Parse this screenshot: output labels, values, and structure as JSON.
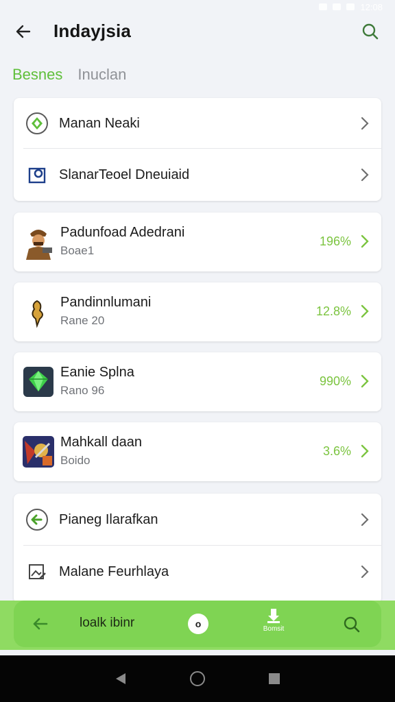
{
  "status_bar": {
    "time": "12:08"
  },
  "header": {
    "title": "Indayjsia",
    "back_icon": "arrow-left-icon",
    "search_icon": "search-icon"
  },
  "tabs": [
    {
      "label": "Besnes",
      "active": true
    },
    {
      "label": "Inuclan",
      "active": false
    }
  ],
  "settings_top": [
    {
      "label": "Manan Neaki",
      "icon": "diamond-circle-icon"
    },
    {
      "label": "SlanarTeoel Dneuiaid",
      "icon": "phone-frame-icon"
    }
  ],
  "apps": [
    {
      "title": "Padunfoad Adedrani",
      "sub": "Boae1",
      "percent": "196%",
      "icon": "warrior-character-icon"
    },
    {
      "title": "Pandinnlumani",
      "sub": "Rane 20",
      "percent": "12.8%",
      "icon": "golden-bird-icon"
    },
    {
      "title": "Eanie Splna",
      "sub": "Rano 96",
      "percent": "990%",
      "icon": "green-gem-icon"
    },
    {
      "title": "Mahkall daan",
      "sub": "Boido",
      "percent": "3.6%",
      "icon": "battle-scene-icon"
    }
  ],
  "settings_bottom": [
    {
      "label": "Pianeg Ilarafkan",
      "icon": "arrow-circle-icon"
    },
    {
      "label": "Malane Feurhlaya",
      "icon": "image-edit-icon"
    }
  ],
  "bottom_nav": {
    "back_icon": "arrow-left-icon",
    "label": "loalk ibinr",
    "circle_text": "o",
    "download_label": "Bomsit",
    "search_icon": "search-icon"
  },
  "colors": {
    "accent_green": "#5fbf3b",
    "percent_green": "#7bc43f",
    "nav_green": "#7fd453"
  }
}
